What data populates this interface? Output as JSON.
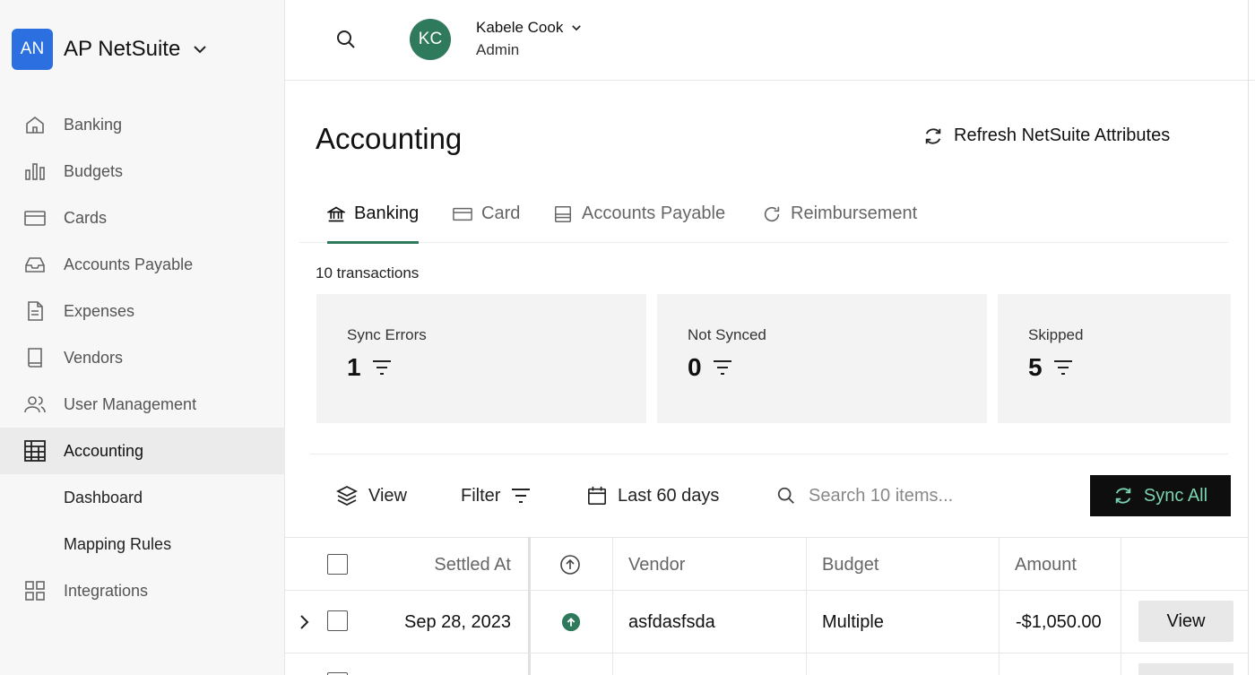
{
  "brand": {
    "initials": "AN",
    "name": "AP NetSuite"
  },
  "sidebar": {
    "items": [
      {
        "label": "Banking",
        "icon": "home-icon"
      },
      {
        "label": "Budgets",
        "icon": "bar-chart-icon"
      },
      {
        "label": "Cards",
        "icon": "credit-card-icon"
      },
      {
        "label": "Accounts Payable",
        "icon": "inbox-icon"
      },
      {
        "label": "Expenses",
        "icon": "document-icon"
      },
      {
        "label": "Vendors",
        "icon": "book-icon"
      },
      {
        "label": "User Management",
        "icon": "users-icon"
      },
      {
        "label": "Accounting",
        "icon": "table-icon",
        "active": true
      },
      {
        "label": "Dashboard",
        "sub": true
      },
      {
        "label": "Mapping Rules",
        "sub": true
      },
      {
        "label": "Integrations",
        "icon": "grid-icon"
      }
    ]
  },
  "user": {
    "initials": "KC",
    "name": "Kabele Cook",
    "role": "Admin"
  },
  "page": {
    "title": "Accounting",
    "refresh_label": "Refresh NetSuite Attributes",
    "tabs": [
      {
        "label": "Banking",
        "icon": "bank-icon",
        "active": true
      },
      {
        "label": "Card",
        "icon": "credit-card-icon"
      },
      {
        "label": "Accounts Payable",
        "icon": "inbox-icon"
      },
      {
        "label": "Reimbursement",
        "icon": "refresh-icon"
      }
    ],
    "transaction_count": "10 transactions",
    "stats": [
      {
        "label": "Sync Errors",
        "value": "1"
      },
      {
        "label": "Not Synced",
        "value": "0"
      },
      {
        "label": "Skipped",
        "value": "5"
      }
    ]
  },
  "toolbar": {
    "view_label": "View",
    "filter_label": "Filter",
    "date_range": "Last 60 days",
    "search_placeholder": "Search 10 items...",
    "sync_all_label": "Sync All"
  },
  "table": {
    "columns": [
      "Settled At",
      "Vendor",
      "Budget",
      "Amount"
    ],
    "rows": [
      {
        "settled_at": "Sep 28, 2023",
        "vendor": "asfdasfsda",
        "budget": "Multiple",
        "amount": "-$1,050.00",
        "action": "View"
      }
    ]
  },
  "colors": {
    "brand": "#2b6fe0",
    "accent": "#2f7a5d",
    "sync_text": "#7ad3b0"
  }
}
